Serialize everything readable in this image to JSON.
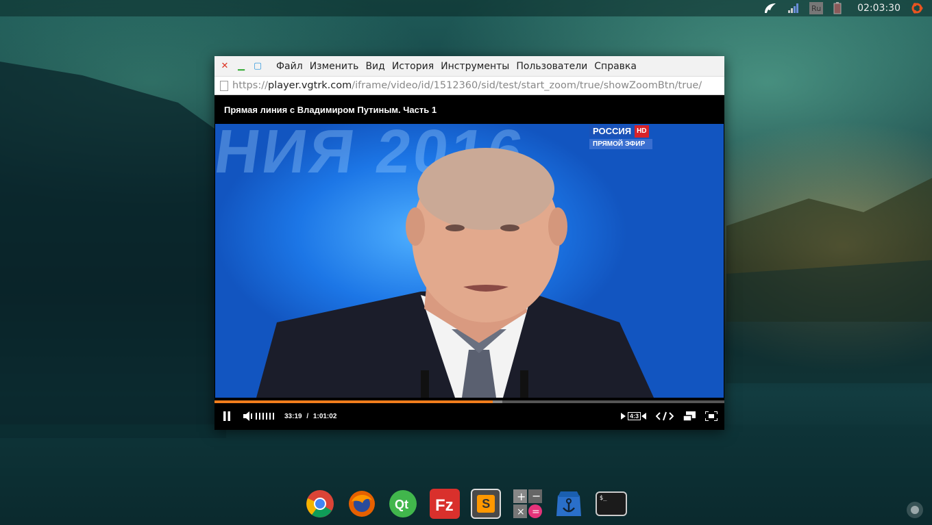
{
  "top_panel": {
    "clock": "02:03:30",
    "keyboard_layout": "Ru",
    "icons": [
      "app-indicator-icon",
      "network-signal-icon",
      "keyboard-layout-icon",
      "battery-icon",
      "ubuntu-logo-icon"
    ]
  },
  "browser": {
    "menu": [
      "Файл",
      "Изменить",
      "Вид",
      "История",
      "Инструменты",
      "Пользователи",
      "Справка"
    ],
    "url": {
      "scheme": "https://",
      "host": "player.vgtrk.com",
      "path": "/iframe/video/id/1512360/sid/test/start_zoom/true/showZoomBtn/true/"
    }
  },
  "player": {
    "title": "Прямая линия с Владимиром Путиным. Часть 1",
    "channel": {
      "name": "РОССИЯ",
      "badge": "HD",
      "live_label": "ПРЯМОЙ ЭФИР"
    },
    "current_time": "33:19",
    "separator": "/",
    "duration": "1:01:02",
    "progress": 0.546,
    "buffered": 0.565,
    "aspect_label": "4:3"
  },
  "dock": {
    "apps": [
      "chrome-icon",
      "firefox-icon",
      "qt-creator-icon",
      "filezilla-icon",
      "sublime-text-icon",
      "calculator-icon",
      "apt-anchor-icon",
      "terminal-icon"
    ],
    "terminal_prompt": "$_"
  },
  "colors": {
    "progress": "#f07d1c",
    "channel_blue": "#1a52b8",
    "channel_hd_red": "#d8232a"
  }
}
